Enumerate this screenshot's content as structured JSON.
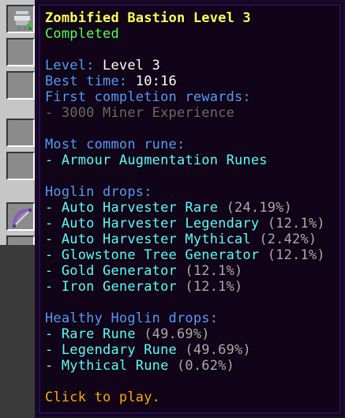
{
  "tooltip": {
    "title": "Zombified Bastion Level 3",
    "status": "Completed",
    "level_label": "Level:",
    "level_value": "Level 3",
    "best_time_label": "Best time:",
    "best_time_value": "10:16",
    "first_rewards_label": "First completion rewards:",
    "first_rewards_items": [
      "- 3000 Miner Experience"
    ],
    "common_rune_label": "Most common rune:",
    "common_rune_items": [
      "- Armour Augmentation Runes"
    ],
    "hoglin_label": "Hoglin drops:",
    "hoglin_drops": [
      {
        "name": "- Auto Harvester Rare",
        "chance": "(24.19%)"
      },
      {
        "name": "- Auto Harvester Legendary",
        "chance": "(12.1%)"
      },
      {
        "name": "- Auto Harvester Mythical",
        "chance": "(2.42%)"
      },
      {
        "name": "- Glowstone Tree Generator",
        "chance": "(12.1%)"
      },
      {
        "name": "- Gold Generator",
        "chance": "(12.1%)"
      },
      {
        "name": "- Iron Generator",
        "chance": "(12.1%)"
      }
    ],
    "healthy_hoglin_label": "Healthy Hoglin drops:",
    "healthy_hoglin_drops": [
      {
        "name": "- Rare Rune",
        "chance": "(49.69%)"
      },
      {
        "name": "- Legendary Rune",
        "chance": "(49.69%)"
      },
      {
        "name": "- Mythical Rune",
        "chance": "(0.62%)"
      }
    ],
    "action_hint": "Click to play."
  },
  "inventory": {
    "item_icons": [
      "armor-stand-icon",
      "bow-icon"
    ]
  },
  "colors": {
    "title": "#ffff55",
    "status": "#55ff55",
    "label": "#5599ff",
    "list": "#55ffff",
    "chance": "#aaaaaa",
    "disabled": "#6a6a6a",
    "hint": "#ffaa00",
    "tooltip_bg": "#110418"
  }
}
